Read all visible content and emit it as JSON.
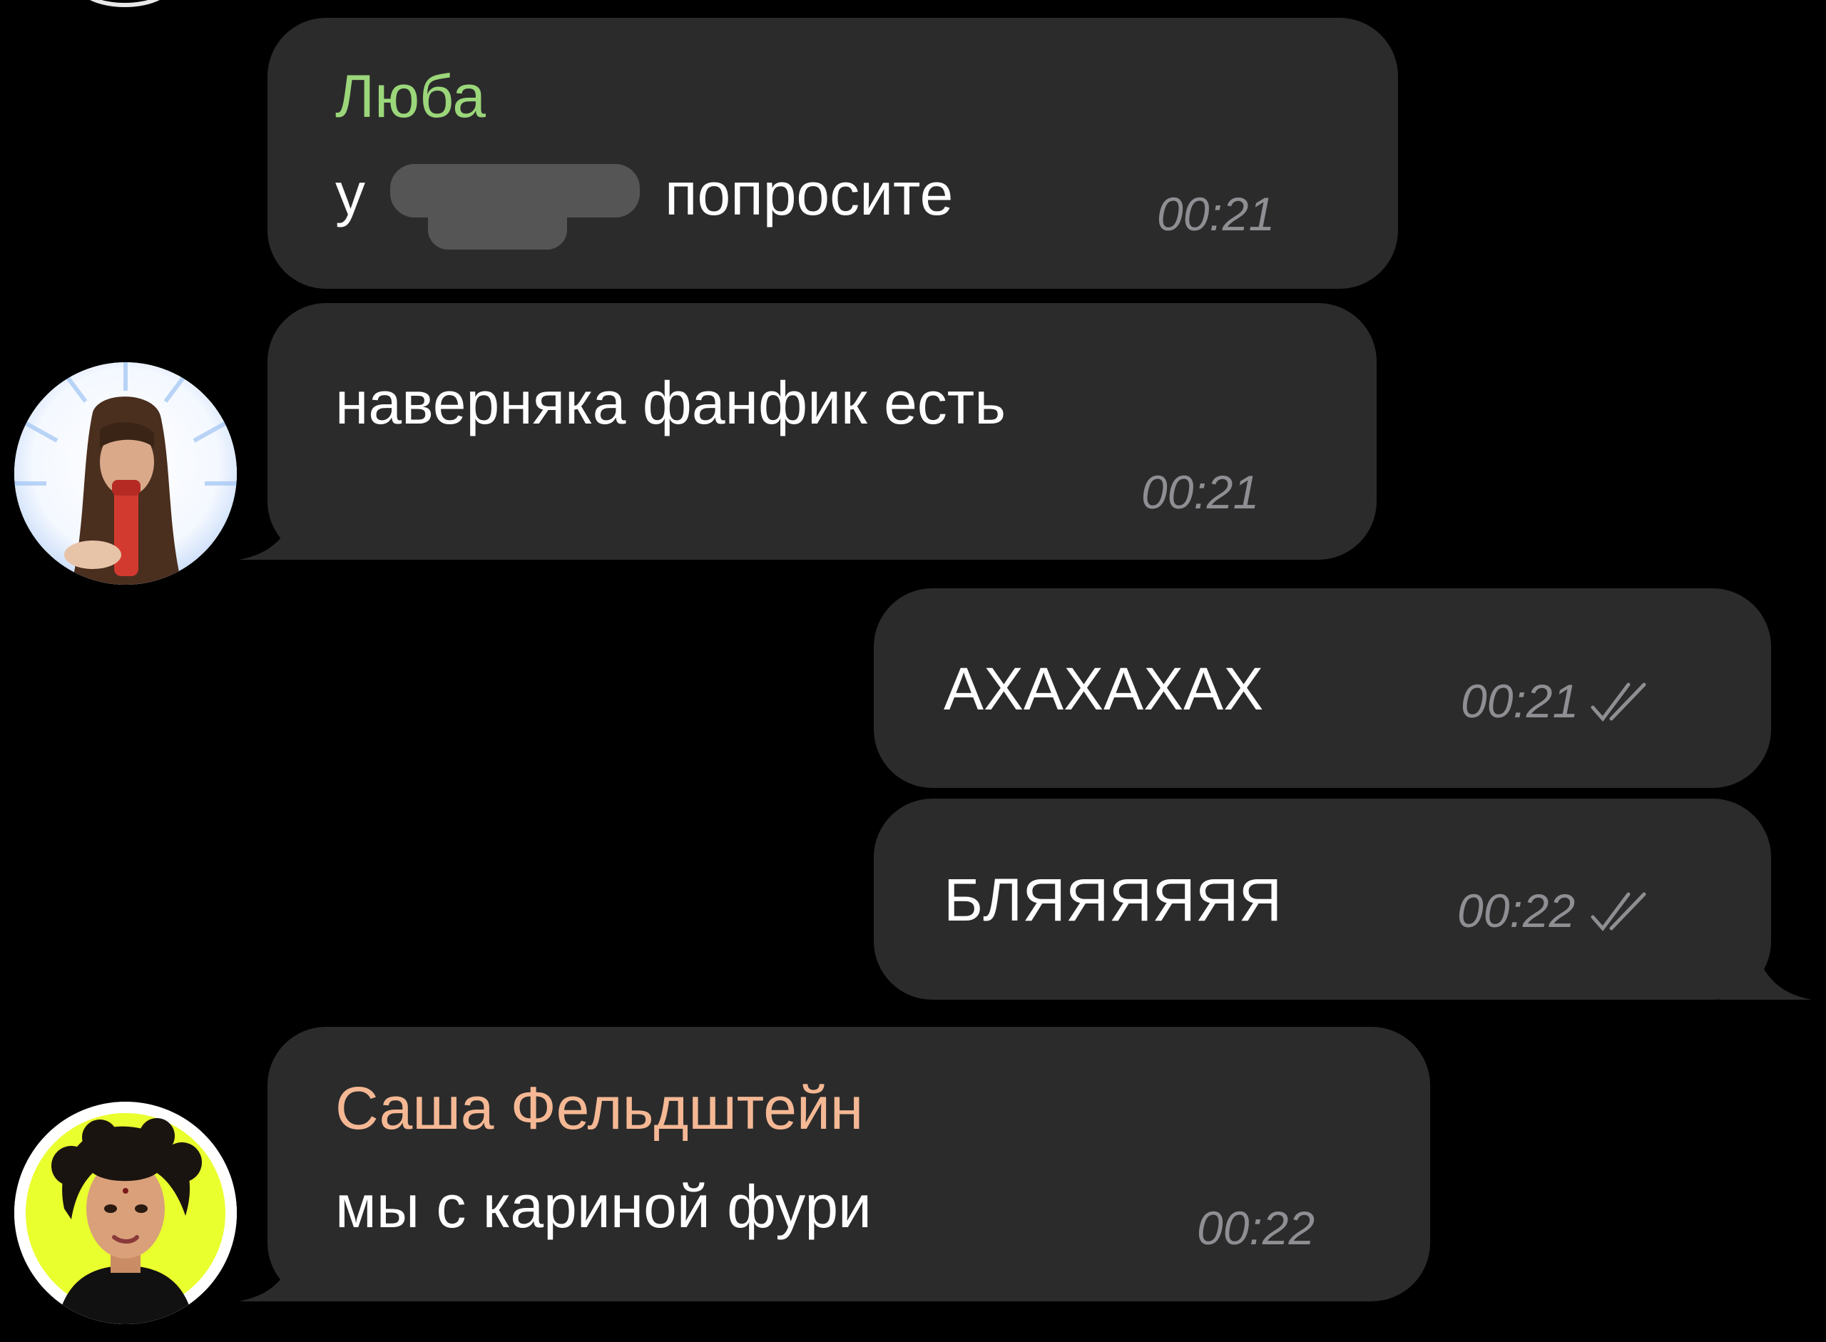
{
  "messages": [
    {
      "sender": "Люба",
      "text_prefix": "у",
      "text_suffix": "попросите",
      "time": "00:21",
      "outgoing": false
    },
    {
      "text": "наверняка фанфик есть",
      "time": "00:21",
      "outgoing": false
    },
    {
      "text": "АХАХАХАХ",
      "time": "00:21",
      "outgoing": true
    },
    {
      "text": "БЛЯЯЯЯЯЯ",
      "time": "00:22",
      "outgoing": true
    },
    {
      "sender": "Саша Фельдштейн",
      "text": "мы с кариной фури",
      "time": "00:22",
      "outgoing": false
    }
  ],
  "colors": {
    "background": "#000000",
    "bubble": "#2b2b2b",
    "sender_luba": "#9bd77a",
    "sender_sasha": "#f5b894",
    "time": "#8e8e93",
    "text": "#ffffff"
  },
  "icons": {
    "read_receipt": "double-check-icon",
    "avatar_1": "user-avatar-long-hair",
    "avatar_2": "user-avatar-curly-hair"
  }
}
